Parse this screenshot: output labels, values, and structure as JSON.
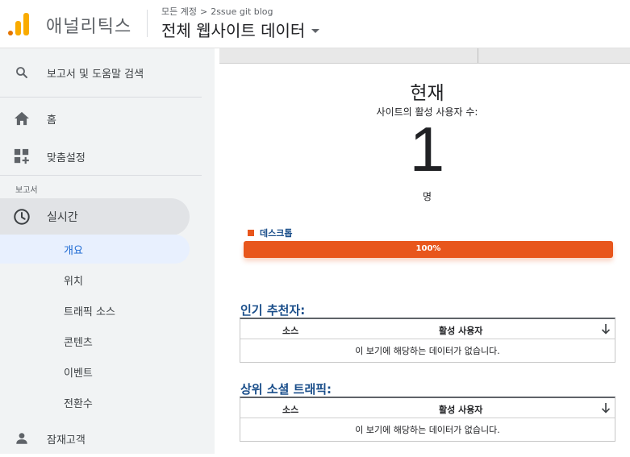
{
  "header": {
    "app_name": "애널리틱스",
    "breadcrumb_all_accounts": "모든 계정",
    "breadcrumb_separator": ">",
    "breadcrumb_property": "2ssue git blog",
    "view_name": "전체 웹사이트 데이터"
  },
  "sidebar": {
    "search_label": "보고서 및 도움말 검색",
    "home_label": "홈",
    "customization_label": "맞춤설정",
    "reports_section_label": "보고서",
    "realtime_label": "실시간",
    "realtime_items": [
      "개요",
      "위치",
      "트래픽 소스",
      "콘텐츠",
      "이벤트",
      "전환수"
    ],
    "audience_label": "잠재고객"
  },
  "main": {
    "now_title": "현재",
    "active_users_label": "사이트의 활성 사용자 수:",
    "active_users_count": "1",
    "count_unit": "명",
    "device_legend": "데스크톱",
    "device_percent_label": "100%",
    "device_share": 1.0,
    "top_referrals": {
      "title": "인기 추천자:",
      "col_source": "소스",
      "col_active_users": "활성 사용자",
      "empty_message": "이 보기에 해당하는 데이터가 없습니다."
    },
    "top_social": {
      "title": "상위 소셜 트래픽:",
      "col_source": "소스",
      "col_active_users": "활성 사용자",
      "empty_message": "이 보기에 해당하는 데이터가 없습니다."
    }
  },
  "colors": {
    "accent_orange": "#e8561c",
    "logo_orange": "#f9ab00",
    "section_title_blue": "#1a4e8a",
    "active_nav_blue": "#1967d2"
  }
}
